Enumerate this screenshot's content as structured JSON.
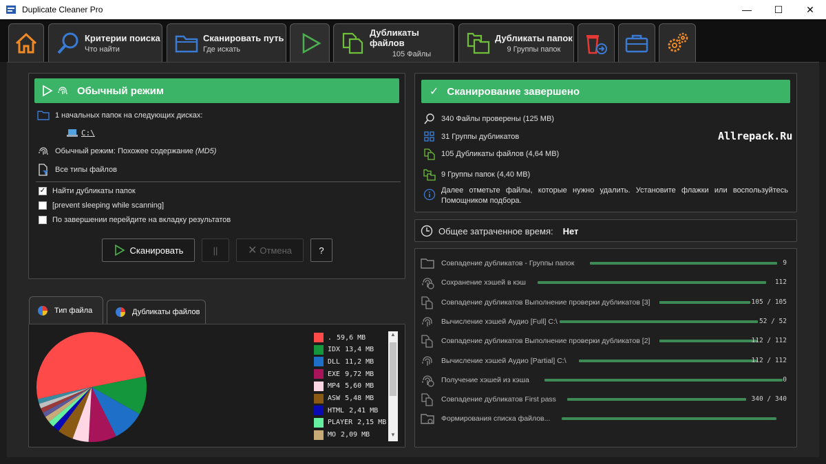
{
  "window": {
    "title": "Duplicate Cleaner Pro"
  },
  "tabs": {
    "search": {
      "main": "Критерии поиска",
      "sub": "Что найти"
    },
    "scan_path": {
      "main": "Сканировать путь",
      "sub": "Где искать"
    },
    "dup_files": {
      "main": "Дубликаты файлов",
      "sub": "105 Файлы"
    },
    "dup_folders": {
      "main": "Дубликаты папок",
      "sub": "9 Группы папок"
    }
  },
  "left_panel": {
    "header": "Обычный режим",
    "folders_text": "1 начальных папок на следующих дисках:",
    "drive": "C:\\",
    "mode_text": "Обычный режим: Похожее содержание",
    "mode_italic": "(MD5)",
    "filetypes_text": "Все типы файлов",
    "options": [
      {
        "label": "Найти дубликаты папок",
        "checked": true
      },
      {
        "label": "[prevent sleeping while scanning]",
        "checked": false
      },
      {
        "label": "По завершении перейдите на вкладку результатов",
        "checked": false
      }
    ],
    "buttons": {
      "scan": "Сканировать",
      "pause": "||",
      "cancel": "Отмена",
      "help": "?"
    }
  },
  "right_panel": {
    "header": "Сканирование завершено",
    "stats": [
      "340 Файлы проверены (125 MB)",
      "31 Группы дубликатов",
      "105 Дубликаты файлов (4,64 MB)",
      "9 Группы папок (4,40 MB)"
    ],
    "info": "Далее отметьте файлы, которые нужно удалить. Установите флажки или воспользуйтесь Помощником подбора.",
    "watermark": "Allrepack.Ru"
  },
  "time_panel": {
    "label": "Общее затраченное время:",
    "value": "Нет"
  },
  "progress": [
    {
      "label": "Совпадение дубликатов - Группы папок",
      "value": "9"
    },
    {
      "label": "Сохранение хэшей в кэш",
      "value": "112"
    },
    {
      "label": "Совпадение дубликатов Выполнение проверки дубликатов [3]",
      "value": "105 / 105"
    },
    {
      "label": "Вычисление хэшей Аудио [Full] C:\\",
      "value": "52 / 52"
    },
    {
      "label": "Совпадение дубликатов Выполнение проверки дубликатов [2]",
      "value": "112 / 112"
    },
    {
      "label": "Вычисление хэшей Аудио [Partial] C:\\",
      "value": "112 / 112"
    },
    {
      "label": "Получение хэшей из кэша",
      "value": "0"
    },
    {
      "label": "Совпадение дубликатов First pass",
      "value": "340 / 340"
    },
    {
      "label": "Формирования списка файлов...",
      "value": ""
    }
  ],
  "chart_tabs": {
    "filetype": "Тип файла",
    "dupfiles": "Дубликаты файлов"
  },
  "chart_data": {
    "type": "pie",
    "title": "",
    "unit": "MB",
    "slices": [
      {
        "label": ".",
        "value": 59.6,
        "display": "59,6 MB",
        "color": "#ff4a4a"
      },
      {
        "label": "IDX",
        "value": 13.4,
        "display": "13,4 MB",
        "color": "#14963c"
      },
      {
        "label": "DLL",
        "value": 11.2,
        "display": "11,2 MB",
        "color": "#1e6fc8"
      },
      {
        "label": "EXE",
        "value": 9.72,
        "display": "9,72 MB",
        "color": "#a8145a"
      },
      {
        "label": "MP4",
        "value": 5.6,
        "display": "5,60 MB",
        "color": "#ffd6e4"
      },
      {
        "label": "ASW",
        "value": 5.48,
        "display": "5,48 MB",
        "color": "#8a5a14"
      },
      {
        "label": "HTML",
        "value": 2.41,
        "display": "2,41 MB",
        "color": "#0a0ab4"
      },
      {
        "label": "PLAYER",
        "value": 2.15,
        "display": "2,15 MB",
        "color": "#64f0a0"
      },
      {
        "label": "MO",
        "value": 2.09,
        "display": "2,09 MB",
        "color": "#c8aa78"
      }
    ]
  },
  "colors": {
    "accent_green": "#3cb467",
    "bar_green": "#3e8a55"
  }
}
